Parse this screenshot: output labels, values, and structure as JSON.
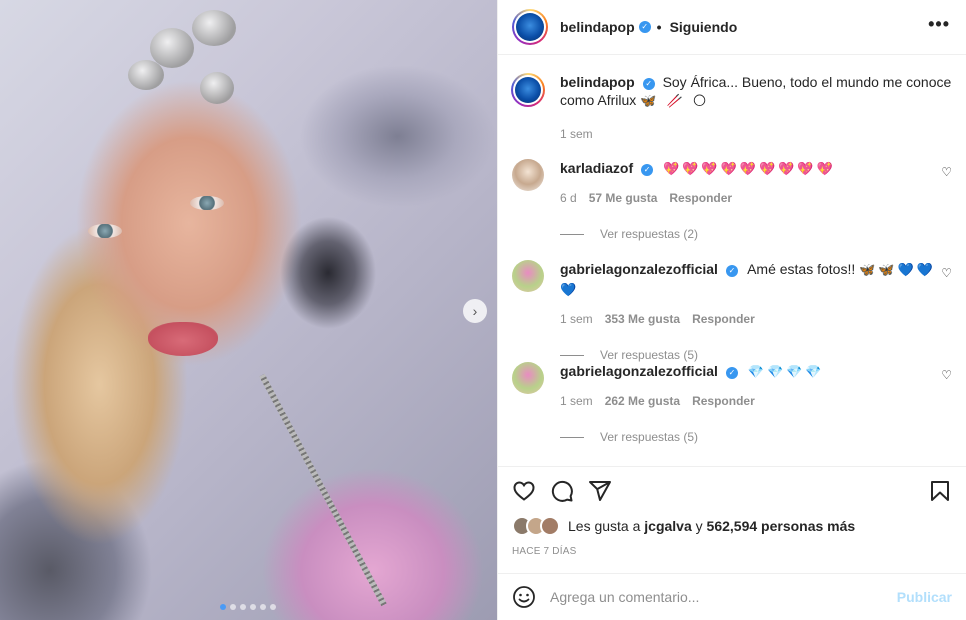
{
  "post": {
    "slide_count": 6,
    "active_slide": 1
  },
  "header": {
    "username": "belindapop",
    "separator": "•",
    "follow_status": "Siguiendo",
    "more_icon": "more-horizontal-icon"
  },
  "caption": {
    "username": "belindapop",
    "text": "Soy África... Bueno, todo el mundo me conoce como Afrilux",
    "emojis": "🦋 🥢 🌕",
    "time": "1 sem"
  },
  "comments": [
    {
      "username": "karladiazof",
      "text": "",
      "emojis": "💖💖💖💖💖💖💖💖💖",
      "time": "6 d",
      "likes": "57 Me gusta",
      "reply_label": "Responder",
      "view_replies": "Ver respuestas (2)"
    },
    {
      "username": "gabrielagonzalezofficial",
      "text": "Amé estas fotos!!",
      "emojis": "🦋🦋💙💙💙",
      "time": "1 sem",
      "likes": "353 Me gusta",
      "reply_label": "Responder",
      "view_replies": "Ver respuestas (5)"
    },
    {
      "username": "gabrielagonzalezofficial",
      "text": "",
      "emojis": "💎💎💎💎",
      "time": "1 sem",
      "likes": "262 Me gusta",
      "reply_label": "Responder",
      "view_replies": "Ver respuestas (5)"
    }
  ],
  "actions": {
    "like_icon": "heart-icon",
    "comment_icon": "comment-icon",
    "share_icon": "send-icon",
    "save_icon": "bookmark-icon"
  },
  "likes": {
    "prefix": "Les gusta a",
    "user": "jcgalva",
    "middle": "y",
    "count": "562,594 personas más"
  },
  "posted": "HACE 7 DÍAS",
  "add_comment": {
    "placeholder": "Agrega un comentario...",
    "publish_label": "Publicar",
    "emoji_icon": "smiley-icon"
  },
  "colors": {
    "verified": "#3897f0",
    "publish_disabled": "#b2dffc",
    "muted": "#8e8e8e",
    "text": "#262626"
  }
}
